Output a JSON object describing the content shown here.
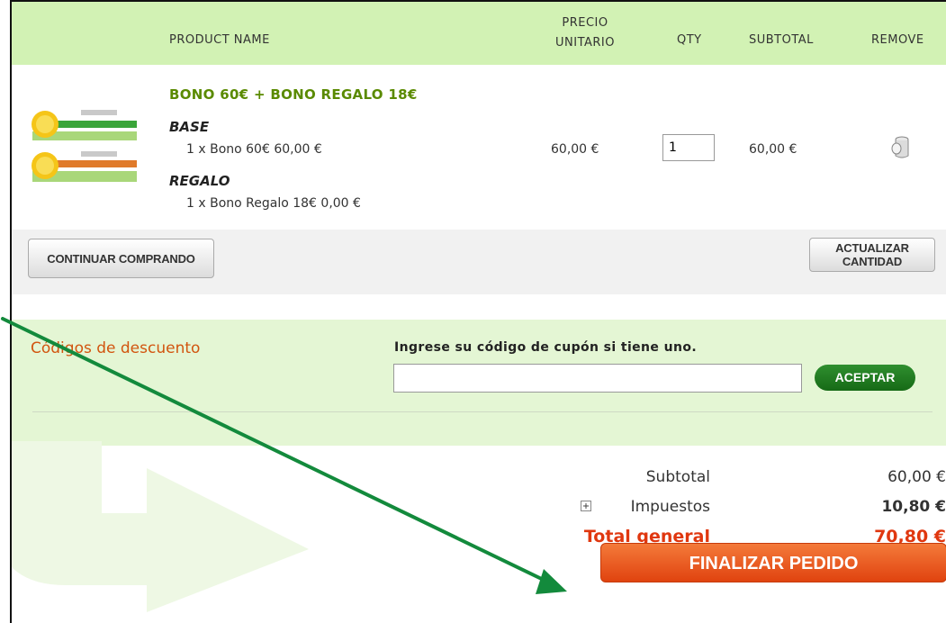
{
  "table": {
    "headers": {
      "product_name": "PRODUCT NAME",
      "unit_price_line1": "PRECIO",
      "unit_price_line2": "UNITARIO",
      "qty": "QTY",
      "subtotal": "SUBTOTAL",
      "remove": "REMOVE"
    },
    "item": {
      "name": "BONO 60€ + BONO REGALO 18€",
      "options": [
        {
          "title": "BASE",
          "value": "1 x Bono 60€ 60,00 €"
        },
        {
          "title": "REGALO",
          "value": "1 x Bono Regalo 18€ 0,00 €"
        }
      ],
      "unit_price": "60,00 €",
      "qty": "1",
      "subtotal": "60,00 €",
      "remove_icon": "trash-icon"
    }
  },
  "actions": {
    "continue_label": "CONTINUAR COMPRANDO",
    "update_line1": "ACTUALIZAR",
    "update_line2": "CANTIDAD"
  },
  "discount": {
    "title": "Códigos de descuento",
    "label": "Ingrese su código de cupón si tiene uno.",
    "input_value": "",
    "accept_label": "ACEPTAR"
  },
  "totals": {
    "subtotal_label": "Subtotal",
    "subtotal_value": "60,00 €",
    "tax_label": "Impuestos",
    "tax_value": "10,80 €",
    "grand_label": "Total general",
    "grand_value": "70,80 €",
    "expand_icon": "plus-box-icon"
  },
  "checkout_label": "FINALIZAR PEDIDO",
  "colors": {
    "header_bg": "#d2f2b4",
    "accent_green": "#5a8a00",
    "accent_orange": "#e0430f",
    "annotation_arrow": "#138a3c"
  }
}
